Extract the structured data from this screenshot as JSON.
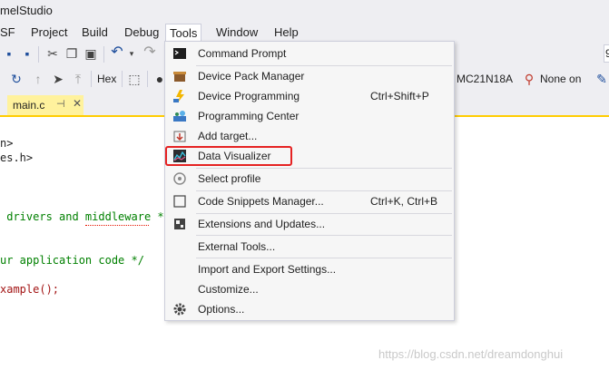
{
  "title": "melStudio",
  "menubar": [
    "SF",
    "Project",
    "Build",
    "Debug",
    "Tools",
    "Window",
    "Help"
  ],
  "toolbar": {
    "hex_label": "Hex",
    "device_label": "MC21N18A",
    "tool_label": "None on",
    "combo_text": "9"
  },
  "tab": {
    "name": "main.c",
    "pin": "⊣",
    "close": "✕"
  },
  "code_lines": [
    {
      "text": "n>",
      "color": "dark"
    },
    {
      "text": "es.h>",
      "color": "dark"
    },
    {
      "text": " drivers and middleware */",
      "color": "green"
    },
    {
      "text": "ur application code */",
      "color": "green"
    },
    {
      "text": "xample();",
      "color": "red"
    }
  ],
  "tools_menu": [
    {
      "label": "Command Prompt",
      "shortcut": "",
      "icon": "command-prompt-icon"
    },
    {
      "label": "Device Pack Manager",
      "shortcut": "",
      "icon": "package-icon"
    },
    {
      "label": "Device Programming",
      "shortcut": "Ctrl+Shift+P",
      "icon": "programming-icon"
    },
    {
      "label": "Programming Center",
      "shortcut": "",
      "icon": "programming-center-icon"
    },
    {
      "label": "Add target...",
      "shortcut": "",
      "icon": "add-target-icon"
    },
    {
      "label": "Data Visualizer",
      "shortcut": "",
      "icon": "chart-icon"
    },
    {
      "label": "Select profile",
      "shortcut": "",
      "icon": "profile-icon"
    },
    {
      "label": "Code Snippets Manager...",
      "shortcut": "Ctrl+K, Ctrl+B",
      "icon": "snippets-icon"
    },
    {
      "label": "Extensions and Updates...",
      "shortcut": "",
      "icon": "extensions-icon"
    },
    {
      "label": "External Tools...",
      "shortcut": "",
      "icon": ""
    },
    {
      "label": "Import and Export Settings...",
      "shortcut": "",
      "icon": ""
    },
    {
      "label": "Customize...",
      "shortcut": "",
      "icon": ""
    },
    {
      "label": "Options...",
      "shortcut": "",
      "icon": "gear-icon"
    }
  ],
  "watermark": "https://blog.csdn.net/dreamdonghui",
  "colors": {
    "accent_highlight": "#e52222",
    "tab_active": "#fff29d",
    "tab_border": "#ffcc00"
  }
}
